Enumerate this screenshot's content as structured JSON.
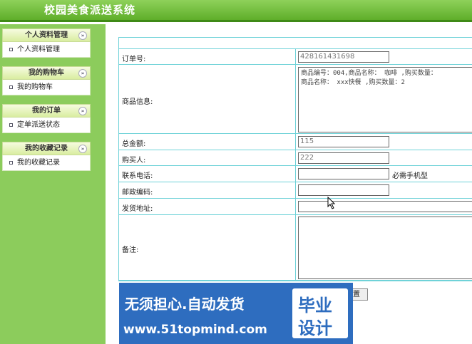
{
  "header": {
    "title": "校园美食派送系统"
  },
  "sidebar": {
    "groups": [
      {
        "title": "个人资料管理",
        "item": "个人资料管理"
      },
      {
        "title": "我的购物车",
        "item": "我的购物车"
      },
      {
        "title": "我的订单",
        "item": "定单派送状态"
      },
      {
        "title": "我的收藏记录",
        "item": "我的收藏记录"
      }
    ],
    "toggle_glyph": "»"
  },
  "form": {
    "order_no_label": "订单号:",
    "order_no_value": "428161431698",
    "goods_label": "商品信息:",
    "goods_line1": "商品编号：004,商品名称： 咖啡 ,购买数量：",
    "goods_line2": "商品名称： xxx快餐 ,购买数量：2",
    "total_label": "总金额:",
    "total_value": "115",
    "buyer_label": "购买人:",
    "buyer_value": "222",
    "phone_label": "联系电话:",
    "phone_value": "",
    "phone_hint": "必需手机型",
    "zip_label": "邮政编码:",
    "zip_value": "",
    "address_label": "发货地址:",
    "address_value": "",
    "remark_label": "备注:",
    "remark_value": "",
    "submit_label": "置"
  },
  "watermark": {
    "line1": "无须担心.自动发货",
    "line2": "www.51topmind.com",
    "badge_line1": "毕业",
    "badge_line2": "设计"
  },
  "colors": {
    "header_green": "#5fae2a",
    "sidebar_green": "#8ccc5c",
    "table_border": "#6fd2d8",
    "watermark_blue": "#2e6dbf"
  }
}
